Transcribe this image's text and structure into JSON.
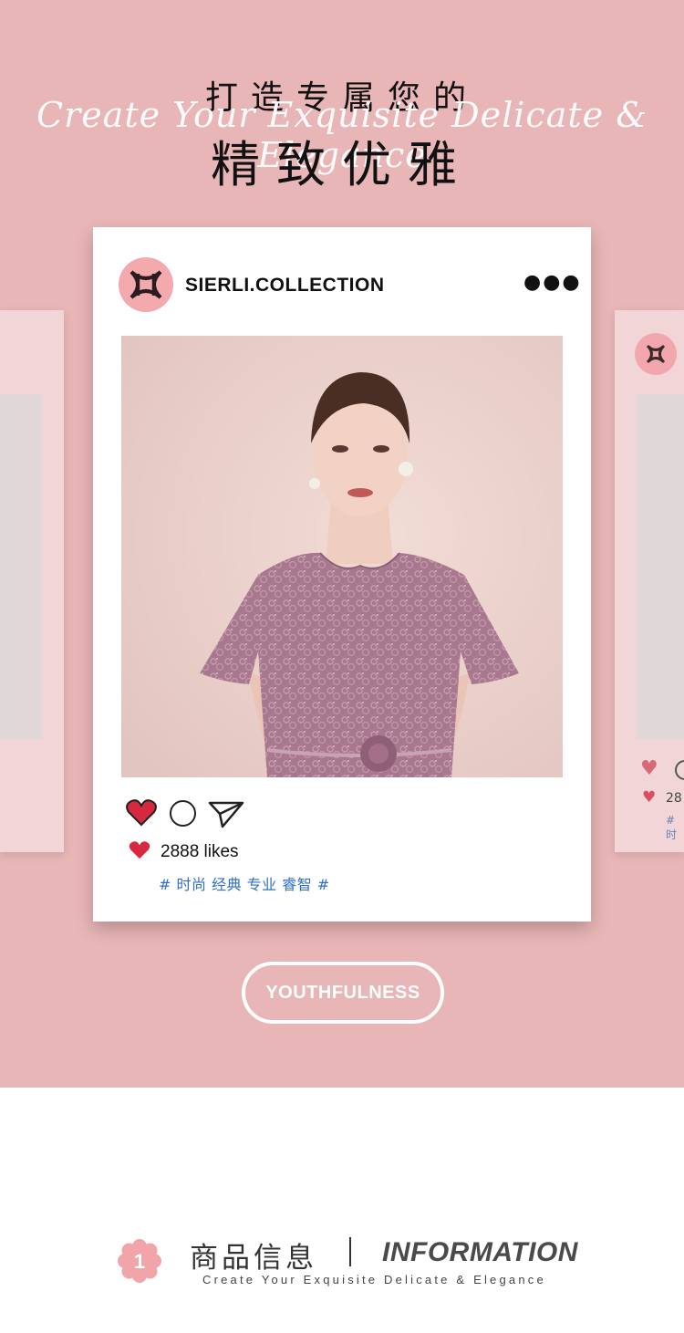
{
  "header": {
    "title_line1": "打造专属您的",
    "script_text": "Create Your Exquisite Delicate & Elegance",
    "title_line2": "精致优雅"
  },
  "post": {
    "username": "SIERLI.COLLECTION",
    "more_icon": "more-dots-icon",
    "likes": "2888 likes",
    "tags": "# 时尚 经典 专业 睿智 #"
  },
  "side_post": {
    "likes_partial": "28",
    "tags_partial": "# 时"
  },
  "pill_label": "YOUTHFULNESS",
  "info": {
    "badge_number": "1",
    "title_cn": "商品信息",
    "title_en": "INFORMATION",
    "subtitle": "Create Your Exquisite Delicate & Elegance"
  },
  "colors": {
    "background_pink": "#e8b6b7",
    "card_side_pink": "#f2d6d7",
    "heart_red": "#d6283f",
    "tag_blue": "#2f6fc6",
    "avatar_pink": "#f3a9ae"
  }
}
